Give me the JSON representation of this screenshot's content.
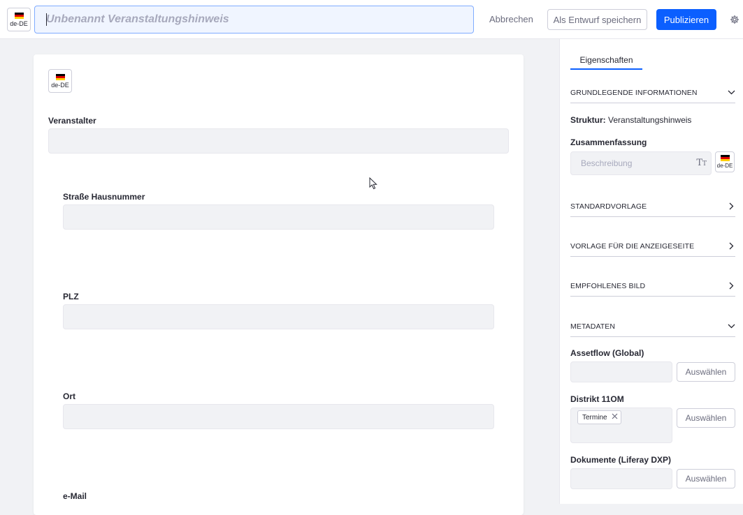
{
  "header": {
    "locale": "de-DE",
    "title_placeholder": "Unbenannt Veranstaltungshinweis",
    "title_value": "",
    "cancel_label": "Abbrechen",
    "save_draft_label": "Als Entwurf speichern",
    "publish_label": "Publizieren",
    "settings_icon": "gear-icon"
  },
  "form": {
    "locale": "de-DE",
    "fields": [
      {
        "label": "Veranstalter",
        "value": ""
      },
      {
        "label": "Straße Hausnummer",
        "value": ""
      },
      {
        "label": "PLZ",
        "value": ""
      },
      {
        "label": "Ort",
        "value": ""
      },
      {
        "label": "e-Mail",
        "value": ""
      }
    ]
  },
  "sidebar": {
    "tab_label": "Eigenschaften",
    "basic_info": {
      "title": "GRUNDLEGENDE INFORMATIONEN",
      "structure_label": "Struktur:",
      "structure_value": "Veranstaltungshinweis",
      "summary_label": "Zusammenfassung",
      "summary_placeholder": "Beschreibung",
      "summary_locale": "de-DE"
    },
    "panels": {
      "default_template": "STANDARDVORLAGE",
      "display_page_template": "VORLAGE FÜR DIE ANZEIGESEITE",
      "featured_image": "EMPFOHLENES BILD",
      "metadata": "METADATEN"
    },
    "metadata": {
      "select_label": "Auswählen",
      "vocabularies": [
        {
          "name": "Assetflow (Global)",
          "tags": []
        },
        {
          "name": "Distrikt 11OM",
          "tags": [
            "Termine"
          ]
        },
        {
          "name": "Dokumente (Liferay DXP)",
          "tags": []
        }
      ]
    }
  },
  "colors": {
    "primary": "#0b5fff",
    "input_bg": "#f1f2f5",
    "text": "#272833",
    "muted": "#6b6c7e"
  }
}
